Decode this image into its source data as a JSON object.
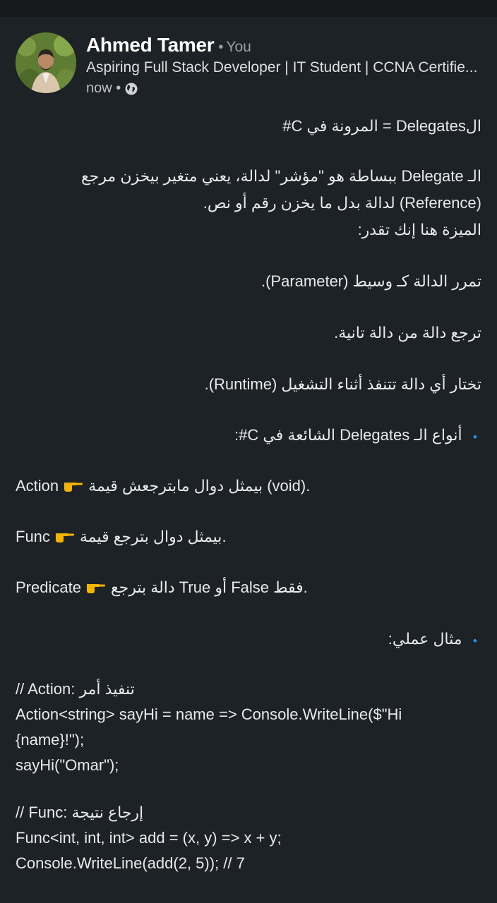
{
  "post": {
    "author": "Ahmed Tamer",
    "dot": "•",
    "you_label": "You",
    "headline": "Aspiring Full Stack Developer | IT Student | CCNA Certifie...",
    "timestamp": "now •"
  },
  "body": {
    "title": "الDelegates = المرونة في C#",
    "def1": "الـ Delegate ببساطة هو \"مؤشر\" لدالة، يعني متغير بيخزن مرجع",
    "def2": "(Reference) لدالة بدل ما يخزن رقم أو نص.",
    "advantage": "الميزة هنا إنك تقدر:",
    "point1": "تمرر الدالة كـ وسيط (Parameter).",
    "point2": "ترجع دالة من دالة تانية.",
    "point3": "تختار أي دالة تتنفذ أثناء التشغيل (Runtime).",
    "types_heading": "أنواع الـ Delegates الشائعة في C#:",
    "bullet": "🔹",
    "action_name": "Action",
    "action_desc": "بيمثل دوال مابترجعش قيمة (void).",
    "func_name": "Func",
    "func_desc": "بيمثل دوال بترجع قيمة.",
    "predicate_name": "Predicate",
    "predicate_desc": "دالة بترجع True أو False فقط.",
    "example_heading": "مثال عملي:",
    "code1_comment": "// Action: تنفيذ أمر",
    "code1_line1": "Action<string> sayHi = name => Console.WriteLine($\"Hi",
    "code1_line2": "{name}!\");",
    "code1_line3": "sayHi(\"Omar\");",
    "code2_comment": "// Func: إرجاع نتيجة",
    "code2_line1": "Func<int, int, int> add = (x, y) => x + y;",
    "code2_line2": "Console.WriteLine(add(2, 5)); // 7"
  },
  "icons": {
    "avatar": "avatar",
    "globe": "globe-icon",
    "pointing": "pointing-hand-icon",
    "diamond": "blue-diamond-icon"
  },
  "colors": {
    "background": "#1d2226",
    "bullet": "#4a90e2",
    "hand": "#f4b400"
  }
}
